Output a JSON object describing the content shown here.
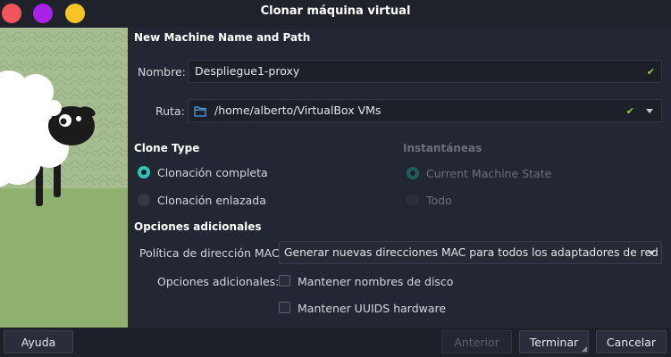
{
  "window": {
    "title": "Clonar máquina virtual"
  },
  "colors": {
    "accent": "#2ec4b6",
    "check": "#8ed81d",
    "close": "#f2555a",
    "minimize": "#a721e8",
    "maximize": "#f7c325"
  },
  "section_name": "New Machine Name and Path",
  "name_field": {
    "label": "Nombre:",
    "value": "Despliegue1-proxy"
  },
  "path_field": {
    "label": "Ruta:",
    "value": "/home/alberto/VirtualBox VMs",
    "icon": "folder-icon"
  },
  "clone_type": {
    "title": "Clone Type",
    "options": [
      {
        "label": "Clonación completa",
        "selected": true
      },
      {
        "label": "Clonación enlazada",
        "selected": false
      }
    ]
  },
  "snapshots": {
    "title": "Instantáneas",
    "options": [
      {
        "label": "Current Machine State",
        "selected": true
      },
      {
        "label": "Todo",
        "selected": false
      }
    ]
  },
  "additional": {
    "title": "Opciones adicionales",
    "mac_label": "Política de dirección MAC:",
    "mac_value": "Generar nuevas direcciones MAC para todos los adaptadores de red",
    "options_label": "Opciones adicionales:",
    "checkboxes": [
      {
        "label": "Mantener nombres de disco",
        "checked": false
      },
      {
        "label": "Mantener UUIDS hardware",
        "checked": false
      }
    ]
  },
  "footer": {
    "help": "Ayuda",
    "back": "Anterior",
    "finish": "Terminar",
    "cancel": "Cancelar"
  }
}
